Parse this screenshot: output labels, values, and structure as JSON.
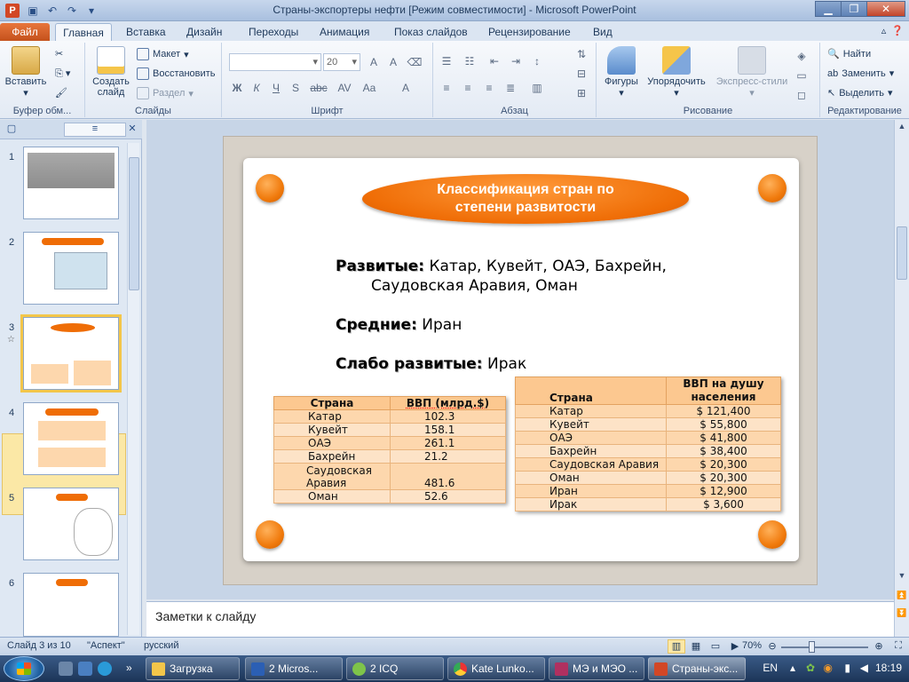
{
  "window": {
    "title": "Страны-экспортеры нефти [Режим совместимости]  -  Microsoft PowerPoint"
  },
  "ribbon": {
    "tabs": [
      "Файл",
      "Главная",
      "Вставка",
      "Дизайн",
      "Переходы",
      "Анимация",
      "Показ слайдов",
      "Рецензирование",
      "Вид"
    ],
    "clipboard": {
      "paste": "Вставить",
      "label": "Буфер обм..."
    },
    "slides": {
      "new_slide": "Создать слайд",
      "layout": "Макет",
      "reset": "Восстановить",
      "section": "Раздел",
      "label": "Слайды"
    },
    "font": {
      "size": "20",
      "label": "Шрифт"
    },
    "paragraph": {
      "label": "Абзац"
    },
    "drawing": {
      "shapes": "Фигуры",
      "arrange": "Упорядочить",
      "quick_styles": "Экспресс-стили",
      "label": "Рисование"
    },
    "editing": {
      "find": "Найти",
      "replace": "Заменить",
      "select": "Выделить",
      "label": "Редактирование"
    }
  },
  "thumbnails": {
    "numbers": [
      "1",
      "2",
      "3",
      "4",
      "5",
      "6"
    ]
  },
  "slide": {
    "title_line1": "Классификация стран по",
    "title_line2": "степени развитости",
    "developed_label": "Развитые:",
    "developed_line1": " Катар, Кувейт, ОАЭ, Бахрейн,",
    "developed_line2": "Саудовская Аравия, Оман",
    "middle_label": "Средние:",
    "middle_value": " Иран",
    "weak_label": "Слабо развитые:",
    "weak_value": " Ирак",
    "table1": {
      "headers": [
        "Страна",
        "ВВП (млрд.$)"
      ],
      "rows": [
        [
          "Катар",
          "102.3"
        ],
        [
          "Кувейт",
          "158.1"
        ],
        [
          "ОАЭ",
          "261.1"
        ],
        [
          "Бахрейн",
          "21.2"
        ],
        [
          "Саудовская Аравия",
          "481.6"
        ],
        [
          "Оман",
          "52.6"
        ]
      ]
    },
    "table2": {
      "headers": [
        "Страна",
        "ВВП на душу населения"
      ],
      "rows": [
        [
          "Катар",
          "$ 121,400"
        ],
        [
          "Кувейт",
          "$ 55,800"
        ],
        [
          "ОАЭ",
          "$ 41,800"
        ],
        [
          "Бахрейн",
          "$ 38,400"
        ],
        [
          "Саудовская Аравия",
          "$ 20,300"
        ],
        [
          "Оман",
          "$ 20,300"
        ],
        [
          "Иран",
          "$ 12,900"
        ],
        [
          "Ирак",
          "$ 3,600"
        ]
      ]
    }
  },
  "notes": {
    "placeholder": "Заметки к слайду"
  },
  "status": {
    "slide_info": "Слайд 3 из 10",
    "theme": "\"Аспект\"",
    "language": "русский",
    "zoom": "70%"
  },
  "taskbar": {
    "tasks": [
      "Загрузка",
      "2 Micros...",
      "2 ICQ",
      "Kate Lunko...",
      "МЭ и МЭО ...",
      "Страны-экс..."
    ],
    "lang": "EN",
    "time": "18:19"
  },
  "colors": {
    "accent": "#ef6d06",
    "table_header": "#fcc890",
    "table_cell": "#fdd7ad"
  }
}
